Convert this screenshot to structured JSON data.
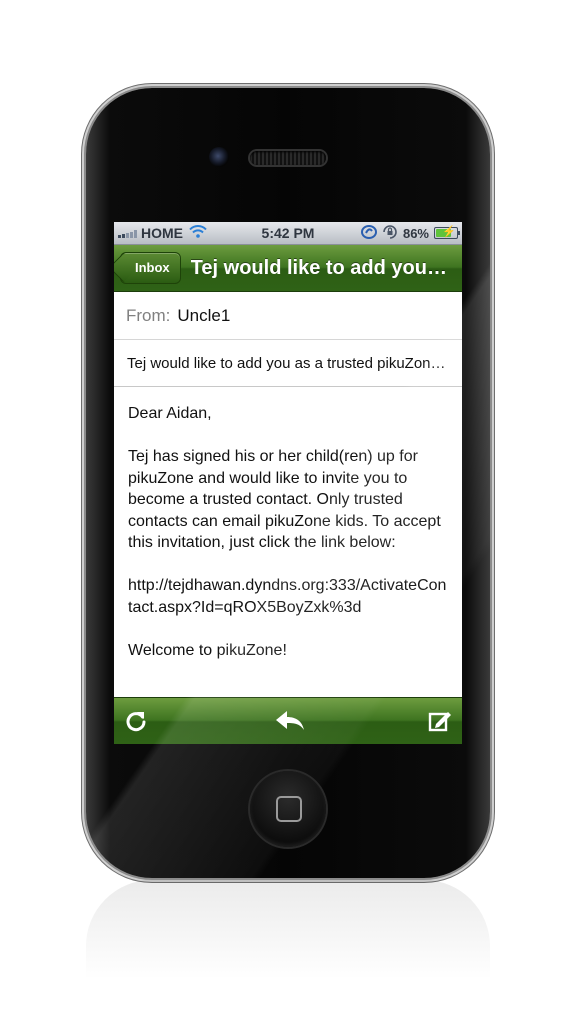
{
  "status_bar": {
    "carrier": "HOME",
    "time": "5:42 PM",
    "battery": "86%",
    "battery_level": 0.86
  },
  "nav": {
    "back_label": "Inbox",
    "title": "Tej would like to add you as a trusted pikuZone contact"
  },
  "message": {
    "from_label": "From:",
    "from_value": "Uncle1",
    "subject": "Tej would like to add you as a trusted pikuZone contact",
    "greeting": "Dear Aidan,",
    "paragraph": "Tej has signed his or her child(ren) up for pikuZone and would like to invite you to become a trusted contact.  Only trusted contacts can email pikuZone kids. To accept this invitation, just click the link below:",
    "link": "http://tejdhawan.dyndns.org:333/ActivateContact.aspx?Id=qROX5BoyZxk%3d",
    "closing": "Welcome to pikuZone!"
  },
  "toolbar": {
    "left_icon": "refresh-icon",
    "center_icon": "reply-icon",
    "right_icon": "compose-icon"
  },
  "colors": {
    "bar_green": "#3e7420",
    "bar_green_light": "#6d9c3f",
    "battery_green": "#5fc33a"
  }
}
